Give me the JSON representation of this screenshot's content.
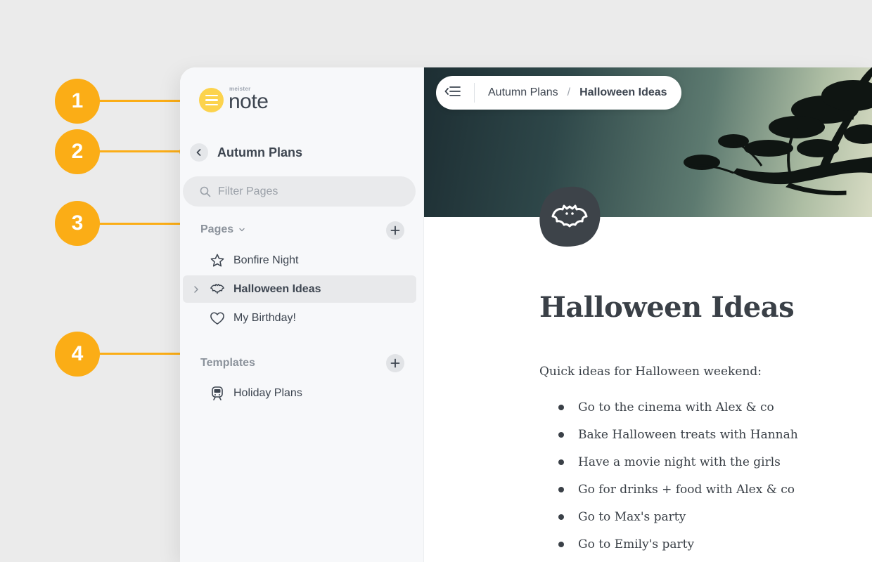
{
  "callouts": [
    "1",
    "2",
    "3",
    "4"
  ],
  "logo": {
    "small_text": "meister",
    "big_text": "note"
  },
  "sidebar": {
    "space_title": "Autumn Plans",
    "filter": {
      "placeholder": "Filter Pages",
      "value": ""
    },
    "pages_section": {
      "label": "Pages"
    },
    "pages": [
      {
        "label": "Bonfire Night",
        "icon": "star-icon"
      },
      {
        "label": "Halloween Ideas",
        "icon": "bat-icon",
        "active": true
      },
      {
        "label": "My Birthday!",
        "icon": "heart-icon"
      }
    ],
    "templates_section": {
      "label": "Templates"
    },
    "templates": [
      {
        "label": "Holiday Plans",
        "icon": "train-icon"
      }
    ]
  },
  "breadcrumb": {
    "items": [
      "Autumn Plans",
      "Halloween Ideas"
    ],
    "separator": "/"
  },
  "page": {
    "title": "Halloween Ideas",
    "intro": "Quick ideas for Halloween weekend:",
    "ideas": [
      "Go to the cinema with Alex & co",
      "Bake Halloween treats with Hannah",
      "Have a movie night with the girls",
      "Go for drinks + food with Alex & co",
      "Go to Max's party",
      "Go to Emily's party"
    ]
  },
  "colors": {
    "accent": "#fbad16",
    "logo": "#fcd34d",
    "text": "#3d4550",
    "sidebar_bg": "#f7f8fa",
    "page_icon_bg": "#3d4349"
  }
}
